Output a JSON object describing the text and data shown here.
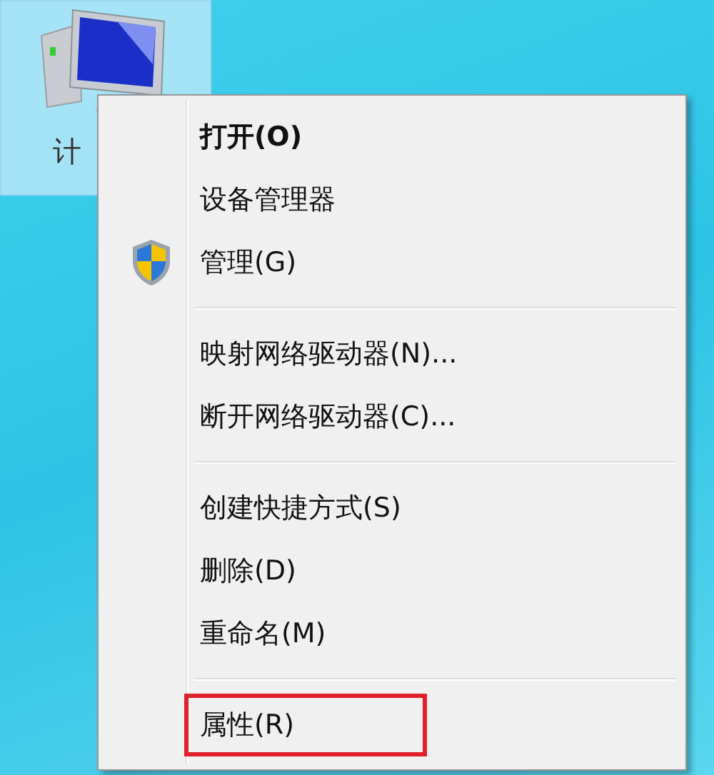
{
  "desktop_icon": {
    "label": "计",
    "selected": true
  },
  "context_menu": {
    "groups": [
      {
        "items": [
          {
            "label": "打开(O)",
            "default": true,
            "kind": "plain",
            "highlighted": false
          },
          {
            "label": "设备管理器",
            "default": false,
            "kind": "plain",
            "highlighted": false
          },
          {
            "label": "管理(G)",
            "default": false,
            "kind": "shield",
            "highlighted": false
          }
        ]
      },
      {
        "items": [
          {
            "label": "映射网络驱动器(N)...",
            "default": false,
            "kind": "plain",
            "highlighted": false
          },
          {
            "label": "断开网络驱动器(C)...",
            "default": false,
            "kind": "plain",
            "highlighted": false
          }
        ]
      },
      {
        "items": [
          {
            "label": "创建快捷方式(S)",
            "default": false,
            "kind": "plain",
            "highlighted": false
          },
          {
            "label": "删除(D)",
            "default": false,
            "kind": "plain",
            "highlighted": false
          },
          {
            "label": "重命名(M)",
            "default": false,
            "kind": "plain",
            "highlighted": false
          }
        ]
      },
      {
        "items": [
          {
            "label": "属性(R)",
            "default": false,
            "kind": "plain",
            "highlighted": true
          }
        ]
      }
    ]
  }
}
